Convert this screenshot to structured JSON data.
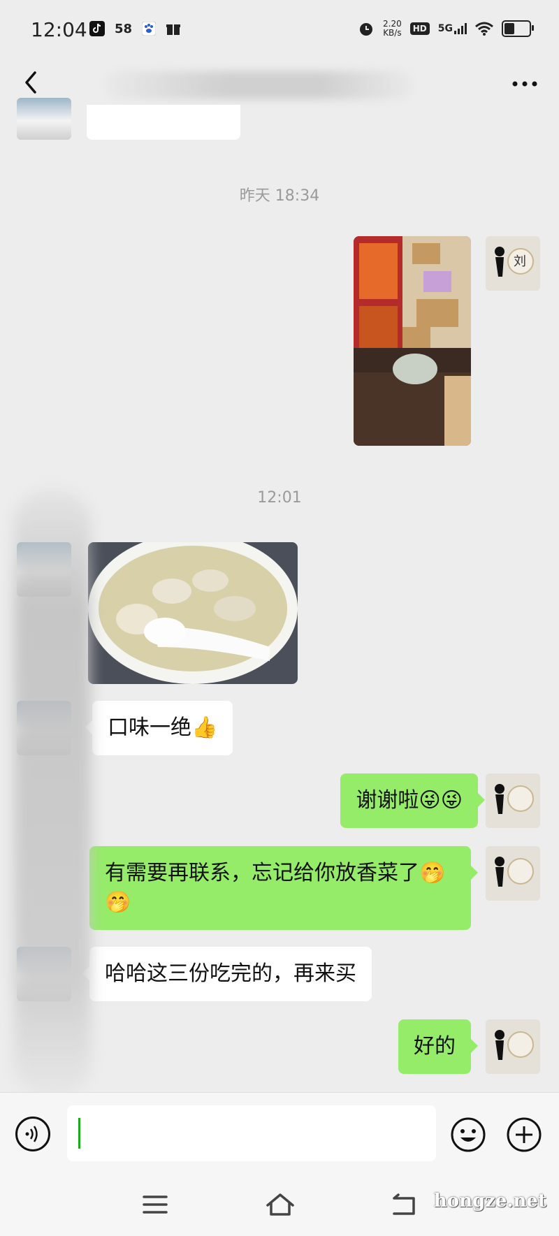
{
  "status_bar": {
    "time": "12:04",
    "left_badges": [
      "58"
    ],
    "net_speed_value": "2.20",
    "net_speed_unit": "KB/s",
    "hd_label": "HD",
    "network_label": "5G"
  },
  "header": {
    "title": ""
  },
  "messages": {
    "timestamp_1": "昨天 18:34",
    "timestamp_2": "12:01",
    "msg_taste": "口味一绝👍",
    "msg_thanks": "谢谢啦😜😜",
    "msg_contact": "有需要再联系，忘记给你放香菜了🤭🤭",
    "msg_finish": "哈哈这三份吃完的，再来买",
    "msg_ok": "好的"
  },
  "avatar_me": {
    "char": "刘"
  },
  "input": {
    "placeholder": ""
  },
  "watermark": "hongze.net",
  "colors": {
    "background": "#ededed",
    "bubble_self": "#95ec69",
    "bubble_other": "#ffffff",
    "caret": "#1aad19"
  }
}
